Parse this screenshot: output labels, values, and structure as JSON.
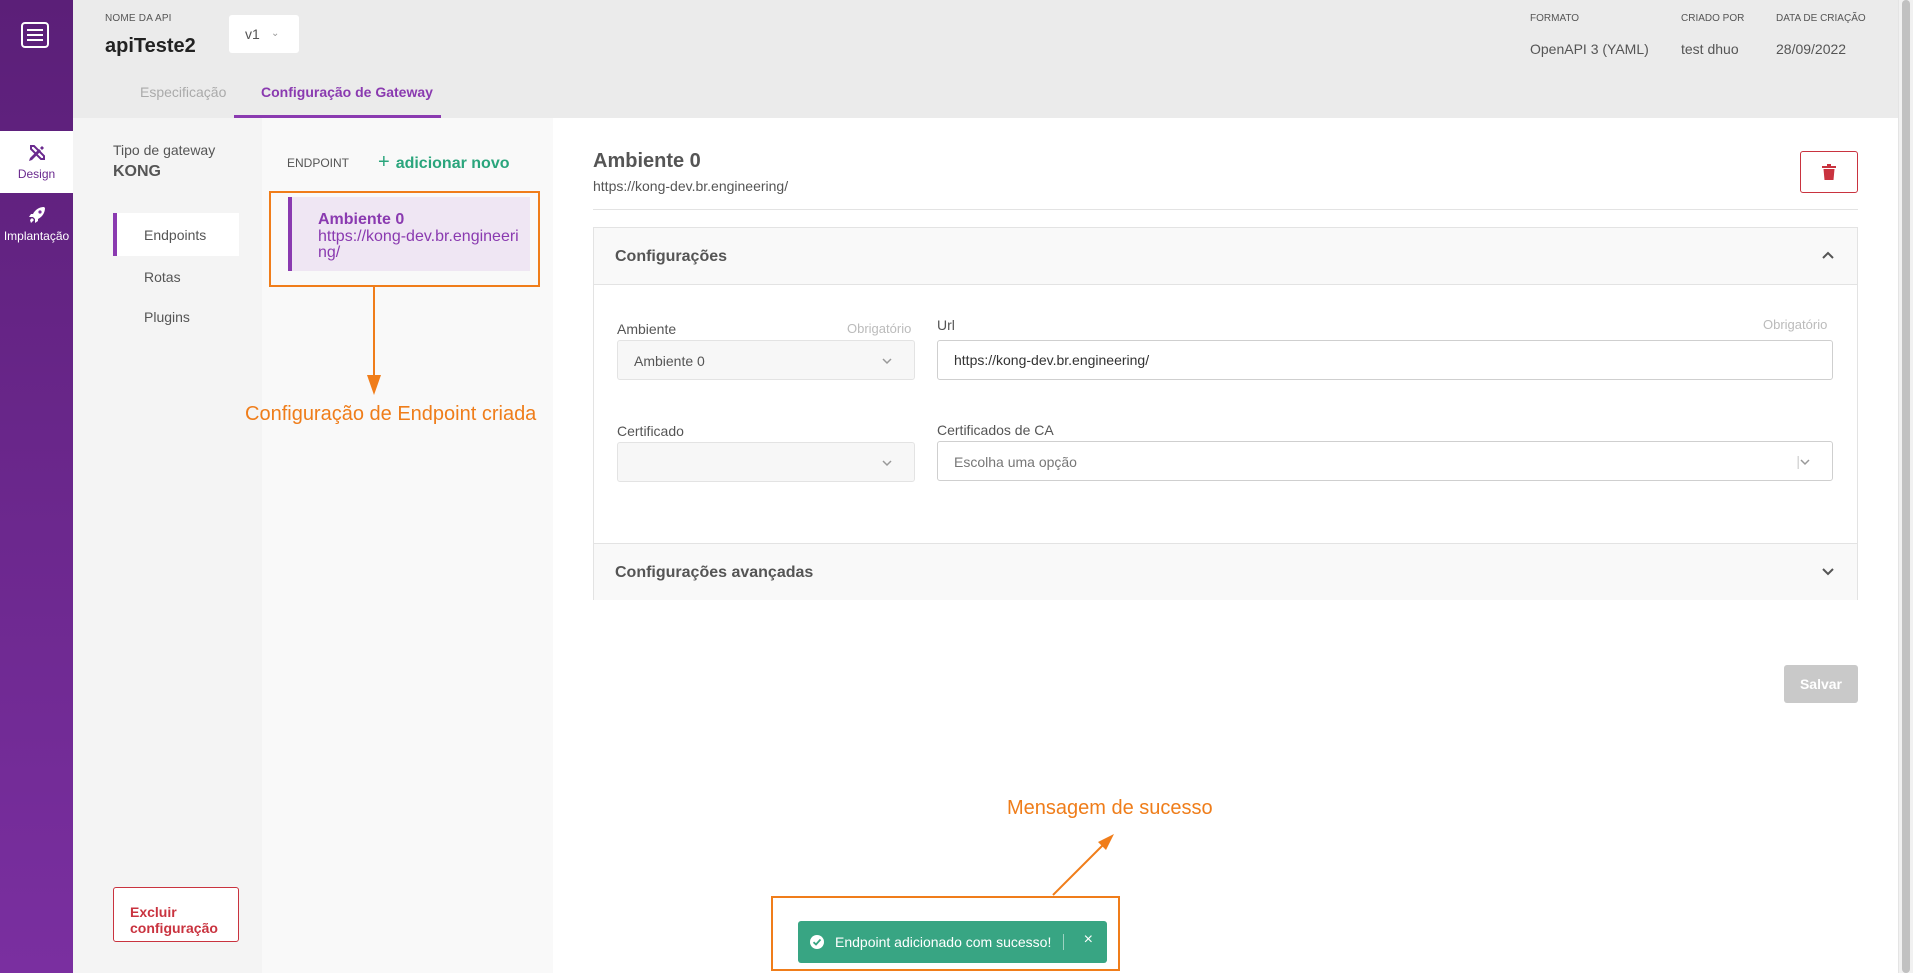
{
  "rail": {
    "design_label": "Design",
    "deploy_label": "Implantação"
  },
  "header": {
    "api_label": "NOME DA API",
    "api_name": "apiTeste2",
    "version": "v1",
    "format_label": "FORMATO",
    "format_value": "OpenAPI 3 (YAML)",
    "created_by_label": "CRIADO POR",
    "created_by_value": "test dhuo",
    "date_label": "DATA DE CRIAÇÃO",
    "date_value": "28/09/2022",
    "tabs": [
      {
        "label": "Especificação",
        "active": false
      },
      {
        "label": "Configuração de Gateway",
        "active": true
      }
    ]
  },
  "subnav": {
    "gateway_type_label": "Tipo de gateway",
    "gateway_type_value": "KONG",
    "items": [
      {
        "label": "Endpoints",
        "active": true
      },
      {
        "label": "Rotas",
        "active": false
      },
      {
        "label": "Plugins",
        "active": false
      }
    ],
    "delete_label": "Excluir configuração"
  },
  "endpoints": {
    "heading": "ENDPOINT",
    "add_label": "adicionar novo",
    "items": [
      {
        "name": "Ambiente 0",
        "url": "https://kong-dev.br.engineering/"
      }
    ]
  },
  "main": {
    "title": "Ambiente 0",
    "url": "https://kong-dev.br.engineering/",
    "config_section": "Configurações",
    "advanced_section": "Configurações avançadas",
    "ambiente_label": "Ambiente",
    "ambiente_value": "Ambiente 0",
    "required_label": "Obrigatório",
    "url_label": "Url",
    "url_value": "https://kong-dev.br.engineering/",
    "cert_label": "Certificado",
    "cert_value": "",
    "ca_label": "Certificados de CA",
    "ca_placeholder": "Escolha uma opção",
    "save_label": "Salvar"
  },
  "toast": {
    "message": "Endpoint adicionado com sucesso!"
  },
  "annotations": {
    "endpoint_created": "Configuração de Endpoint criada",
    "success_message": "Mensagem de sucesso"
  },
  "colors": {
    "primary": "#8a3ab0",
    "accent": "#2aa57c",
    "danger": "#c9333f",
    "annotation": "#ef7d1a"
  }
}
